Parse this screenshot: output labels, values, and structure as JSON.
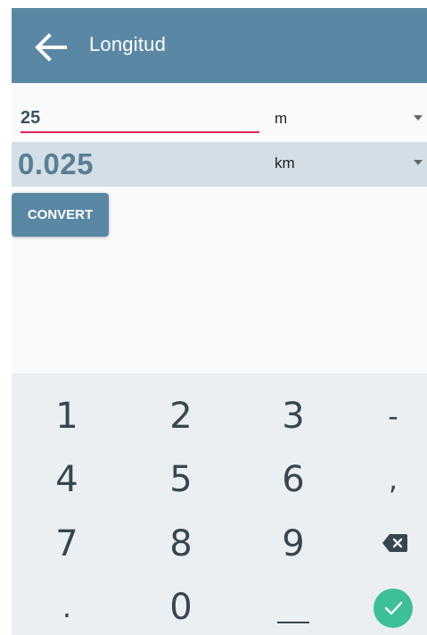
{
  "app_bar": {
    "title": "Longitud",
    "back_icon": "arrow-left-icon"
  },
  "converter": {
    "input_value": "25",
    "input_unit": "m",
    "result_value": "0.025",
    "result_unit": "km",
    "convert_label": "CONVERT"
  },
  "keyboard": {
    "rows": [
      [
        "1",
        "2",
        "3",
        "-"
      ],
      [
        "4",
        "5",
        "6",
        ","
      ],
      [
        "7",
        "8",
        "9",
        "backspace"
      ],
      [
        ".",
        "0",
        "space",
        "done"
      ]
    ],
    "done_color": "#3fbf99"
  },
  "colors": {
    "primary": "#5a88a4",
    "accent_underline": "#e0245e",
    "result_bg": "#d4dee6"
  }
}
